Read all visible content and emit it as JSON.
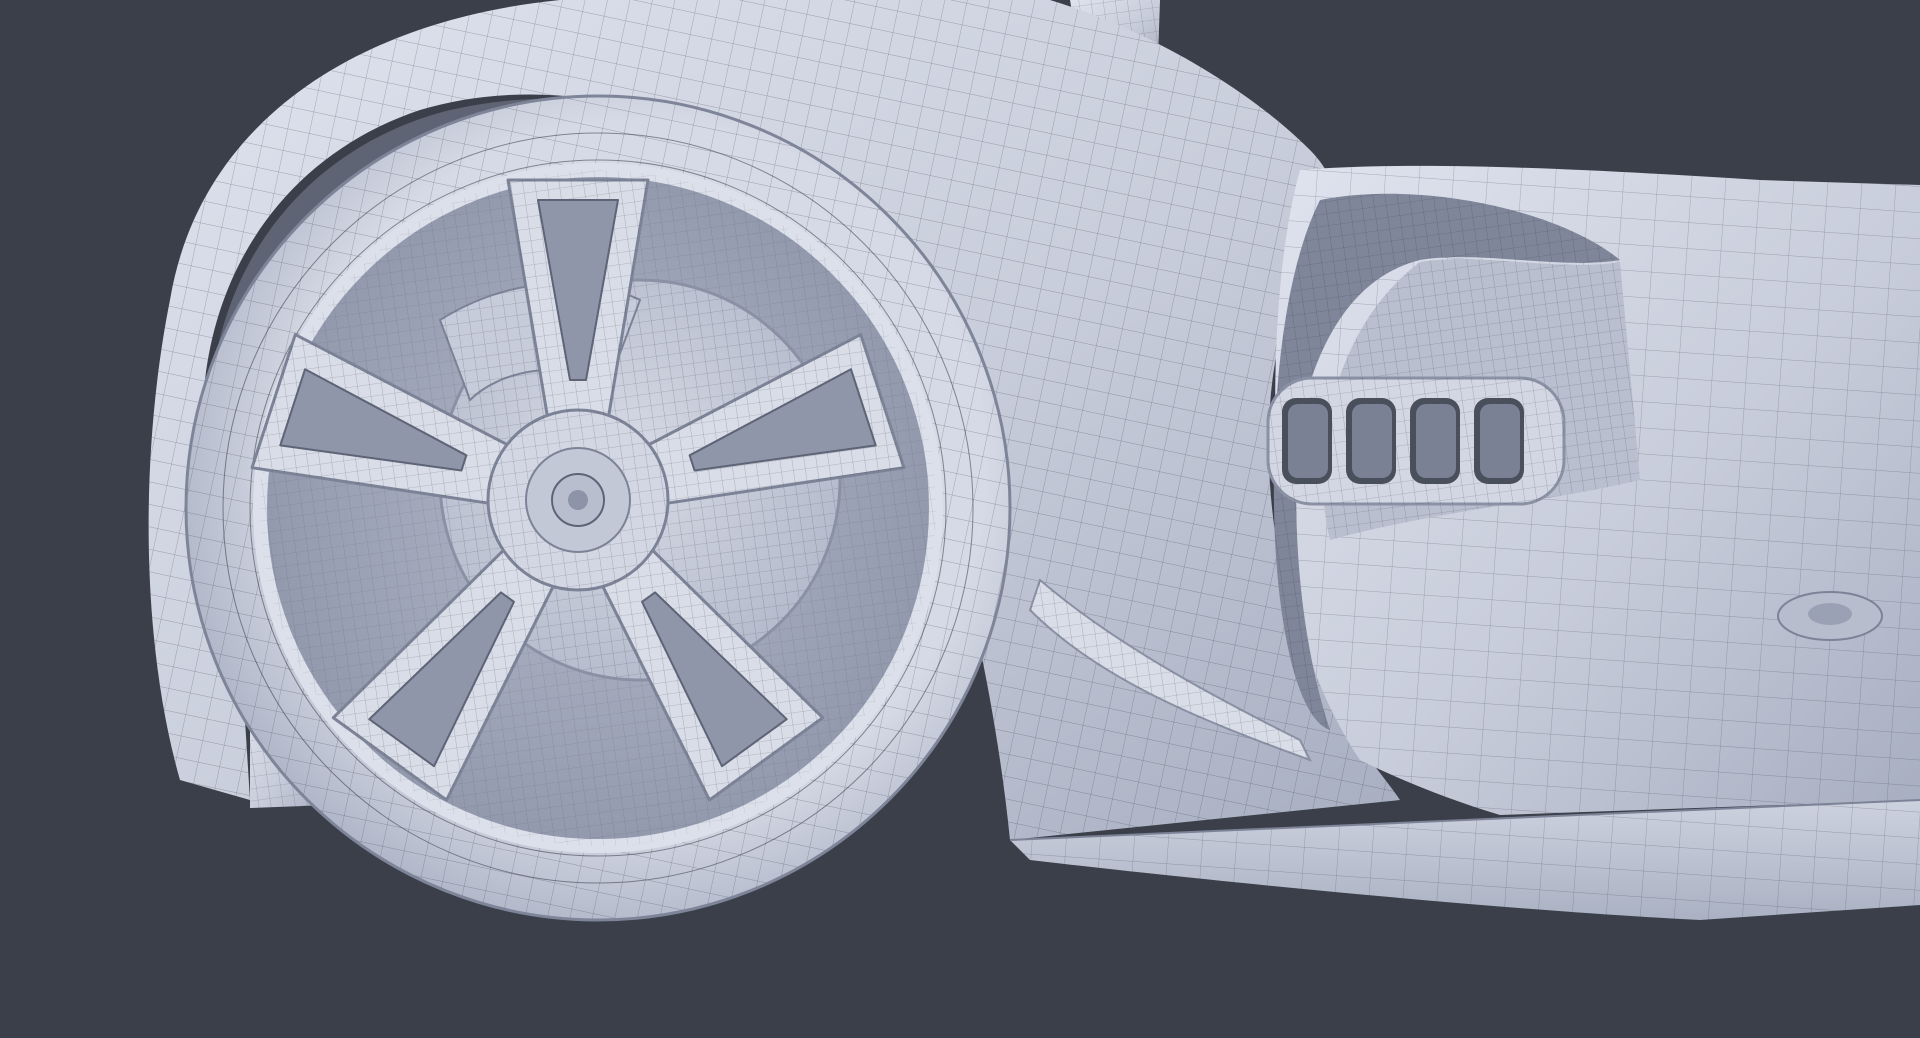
{
  "viewport": {
    "background_color": "#3a3f49",
    "model_color": "#c9cedc",
    "model_highlight": "#e6e9f2",
    "model_shadow": "#8e95a8",
    "wire_color": "#2a2e38"
  },
  "scene": {
    "subject": "wireframe-car-front-wheel",
    "wheel": {
      "spokes": 5,
      "spoke_style": "twin",
      "lug_nuts": 1
    },
    "side_vent": {
      "slots": 4
    }
  }
}
